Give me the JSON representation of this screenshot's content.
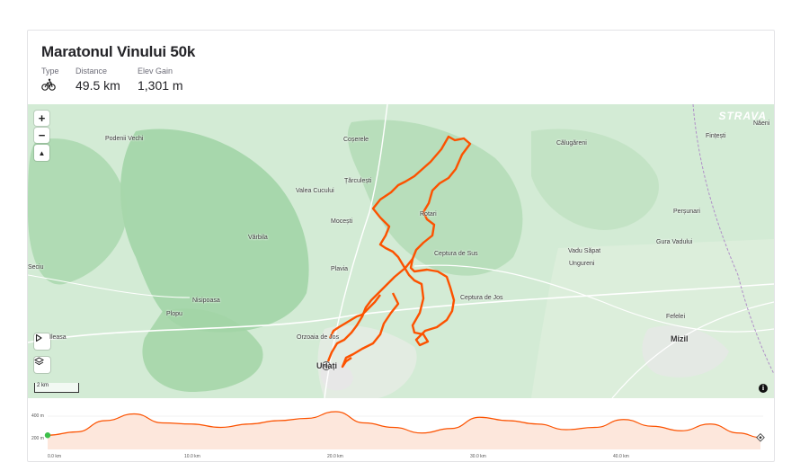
{
  "route": {
    "title": "Maratonul Vinului 50k",
    "stats": [
      {
        "label": "Type",
        "value": "",
        "icon": "bike-icon"
      },
      {
        "label": "Distance",
        "value": "49.5 km"
      },
      {
        "label": "Elev Gain",
        "value": "1,301 m"
      }
    ]
  },
  "map": {
    "brand": "STRAVA",
    "zoom_in": "+",
    "zoom_out": "−",
    "compass": "▲",
    "scale_label": "2 km",
    "info": "i",
    "route_color": "#fc5200",
    "places": [
      {
        "name": "Podenii Vechi"
      },
      {
        "name": "Coșerele"
      },
      {
        "name": "Călugăreni"
      },
      {
        "name": "Fințești"
      },
      {
        "name": "Năeni"
      },
      {
        "name": "Țărculești"
      },
      {
        "name": "Valea Cucului"
      },
      {
        "name": "Rotari"
      },
      {
        "name": "Perșunari"
      },
      {
        "name": "Mocești"
      },
      {
        "name": "Vărbila"
      },
      {
        "name": "Gura Vadului"
      },
      {
        "name": "Ceptura de Sus"
      },
      {
        "name": "Vadu Săpat"
      },
      {
        "name": "Ungureni"
      },
      {
        "name": "Seciu"
      },
      {
        "name": "Plavia"
      },
      {
        "name": "Nisipoasa"
      },
      {
        "name": "Ceptura de Jos"
      },
      {
        "name": "Plopu"
      },
      {
        "name": "Fefelei"
      },
      {
        "name": "Ileasa"
      },
      {
        "name": "Orzoaia de Jos"
      },
      {
        "name": "Mizil"
      },
      {
        "name": "Urlați"
      }
    ]
  },
  "elevation": {
    "y_labels": [
      "400 m",
      "200 m"
    ],
    "x_labels": [
      "0.0 km",
      "10.0 km",
      "20.0 km",
      "30.0 km",
      "40.0 km"
    ],
    "profile_km": [
      0,
      2,
      4,
      6,
      8,
      10,
      12,
      14,
      16,
      18,
      20,
      22,
      24,
      26,
      28,
      30,
      32,
      34,
      36,
      38,
      40,
      42,
      44,
      46,
      48,
      49.5
    ],
    "profile_m": [
      230,
      260,
      360,
      420,
      340,
      330,
      300,
      330,
      360,
      380,
      440,
      340,
      300,
      250,
      290,
      390,
      360,
      330,
      280,
      300,
      370,
      310,
      270,
      330,
      250,
      210
    ]
  }
}
